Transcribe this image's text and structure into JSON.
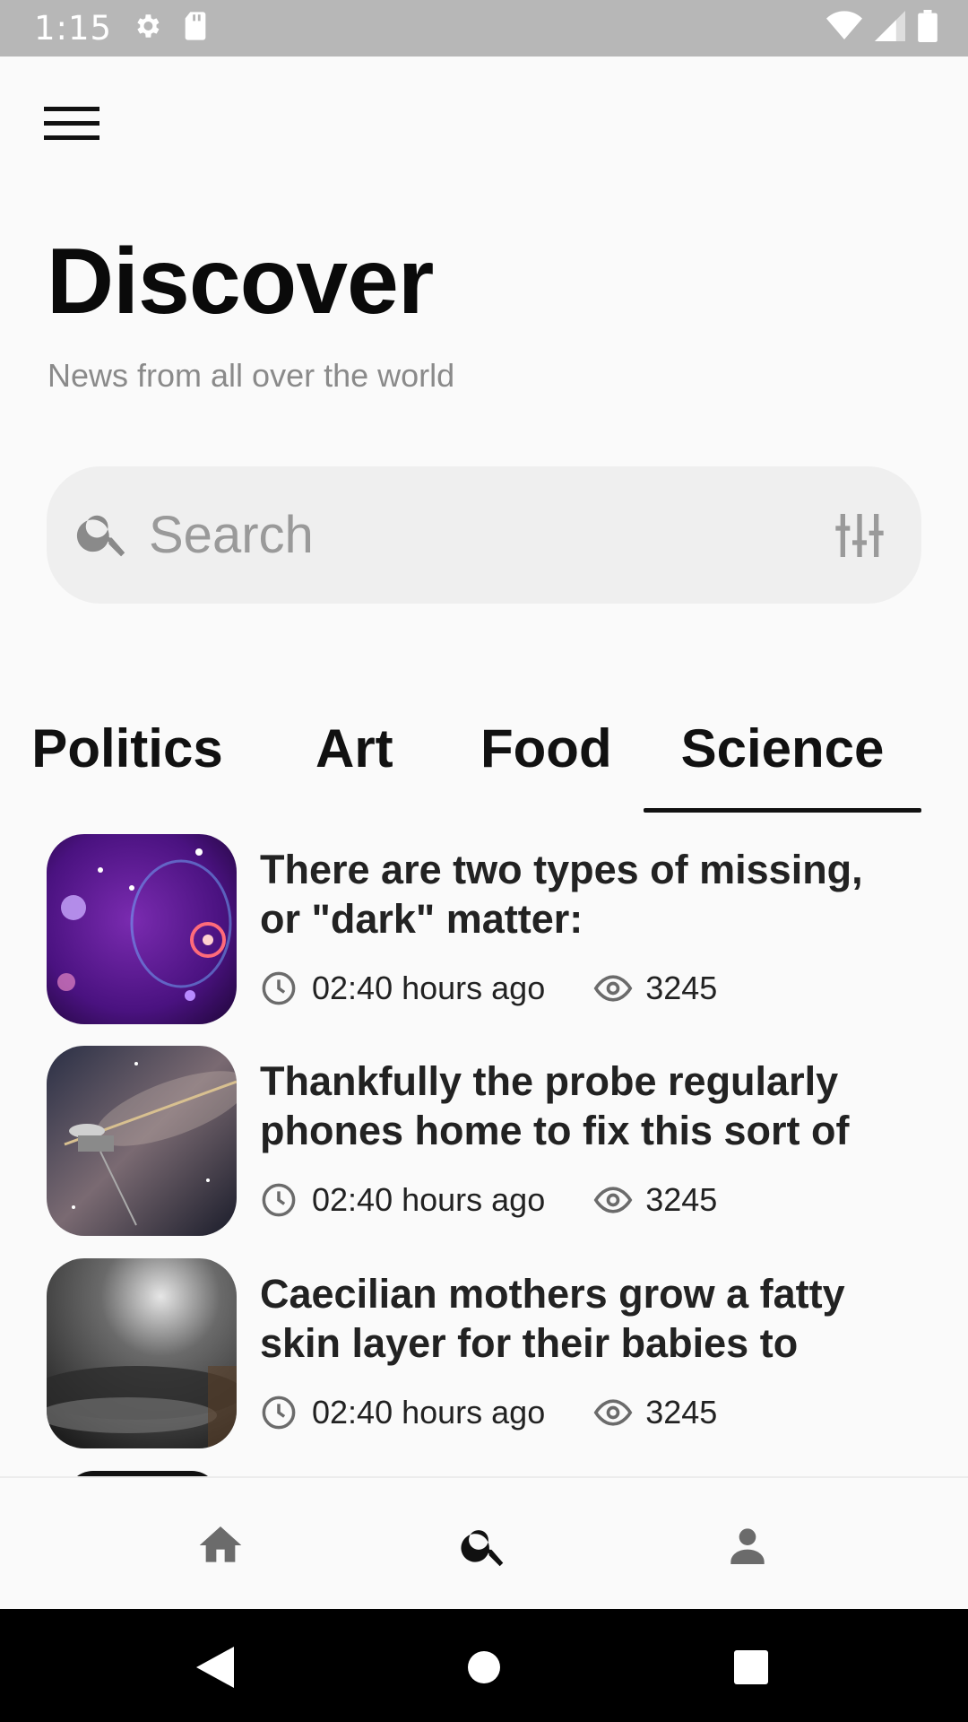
{
  "status_bar": {
    "time": "1:15"
  },
  "header": {
    "title": "Discover",
    "subtitle": "News from all over the world"
  },
  "search": {
    "placeholder": "Search"
  },
  "tabs": [
    {
      "label": "Politics",
      "selected": false
    },
    {
      "label": "Art",
      "selected": false
    },
    {
      "label": "Food",
      "selected": false
    },
    {
      "label": "Science",
      "selected": true
    }
  ],
  "articles": [
    {
      "title": "There are two types of missing, or \"dark\" matter:",
      "time": "02:40 hours ago",
      "views": "3245"
    },
    {
      "title": "Thankfully the probe regularly phones home to fix this sort of",
      "time": "02:40 hours ago",
      "views": "3245"
    },
    {
      "title": "Caecilian mothers grow a fatty skin layer for their babies to",
      "time": "02:40 hours ago",
      "views": "3245"
    }
  ],
  "bottom_nav": [
    {
      "icon": "home-icon",
      "active": false
    },
    {
      "icon": "search-icon",
      "active": true
    },
    {
      "icon": "person-icon",
      "active": false
    }
  ],
  "colors": {
    "background": "#fafafa",
    "status_bar": "#b7b7b7",
    "search_bg": "#efefef",
    "text_primary": "#111111",
    "text_secondary": "#8a8a8a",
    "icon_inactive": "#6b6b6b"
  }
}
